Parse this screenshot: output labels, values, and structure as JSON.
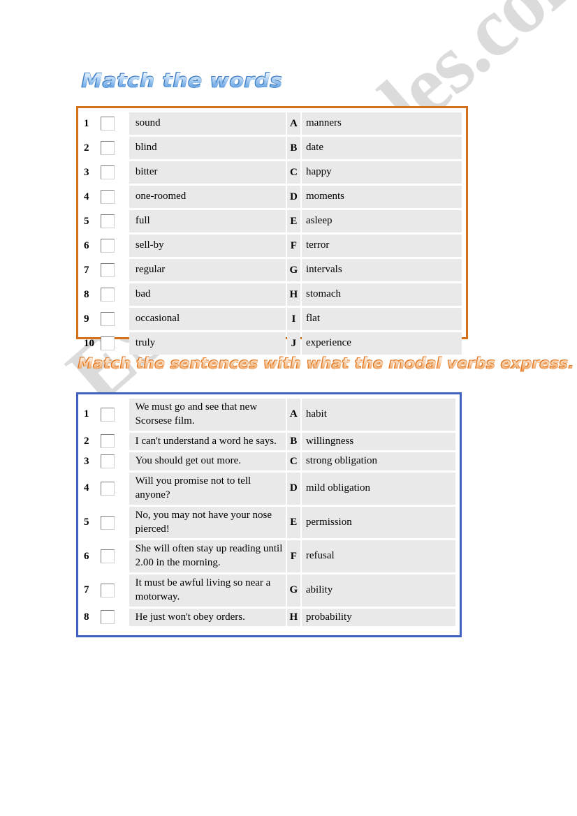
{
  "page": {
    "background_color": "#ffffff",
    "watermark_text": "ESLprintables.com"
  },
  "sections": [
    {
      "heading": "Match the words",
      "heading_color": "#78aee6",
      "border_color": "#d2721c",
      "rows": [
        {
          "num": "1",
          "left": "sound",
          "letter": "A",
          "right": "manners"
        },
        {
          "num": "2",
          "left": "blind",
          "letter": "B",
          "right": "date"
        },
        {
          "num": "3",
          "left": "bitter",
          "letter": "C",
          "right": "happy"
        },
        {
          "num": "4",
          "left": "one-roomed",
          "letter": "D",
          "right": "moments"
        },
        {
          "num": "5",
          "left": "full",
          "letter": "E",
          "right": "asleep"
        },
        {
          "num": "6",
          "left": "sell-by",
          "letter": "F",
          "right": "terror"
        },
        {
          "num": "7",
          "left": "regular",
          "letter": "G",
          "right": "intervals"
        },
        {
          "num": "8",
          "left": "bad",
          "letter": "H",
          "right": "stomach"
        },
        {
          "num": "9",
          "left": "occasional",
          "letter": "I",
          "right": "flat"
        },
        {
          "num": "10",
          "left": "truly",
          "letter": "J",
          "right": "experience"
        }
      ]
    },
    {
      "heading": "Match the sentences with what the modal verbs express.",
      "heading_color": "#f3b882",
      "border_color": "#3d63bf",
      "rows": [
        {
          "num": "1",
          "left": "We must go and see that new Scorsese film.",
          "letter": "A",
          "right": "habit"
        },
        {
          "num": "2",
          "left": "I can't understand a word he says.",
          "letter": "B",
          "right": "willingness"
        },
        {
          "num": "3",
          "left": "You should get out more.",
          "letter": "C",
          "right": "strong obligation"
        },
        {
          "num": "4",
          "left": "Will you promise not to tell anyone?",
          "letter": "D",
          "right": "mild obligation"
        },
        {
          "num": "5",
          "left": "No, you may not have your nose pierced!",
          "letter": "E",
          "right": "permission"
        },
        {
          "num": "6",
          "left": "She will often stay up reading until 2.00 in the morning.",
          "letter": "F",
          "right": "refusal"
        },
        {
          "num": "7",
          "left": "It must be awful living so near a motorway.",
          "letter": "G",
          "right": "ability"
        },
        {
          "num": "8",
          "left": "He just won't obey orders.",
          "letter": "H",
          "right": "probability"
        }
      ]
    }
  ]
}
